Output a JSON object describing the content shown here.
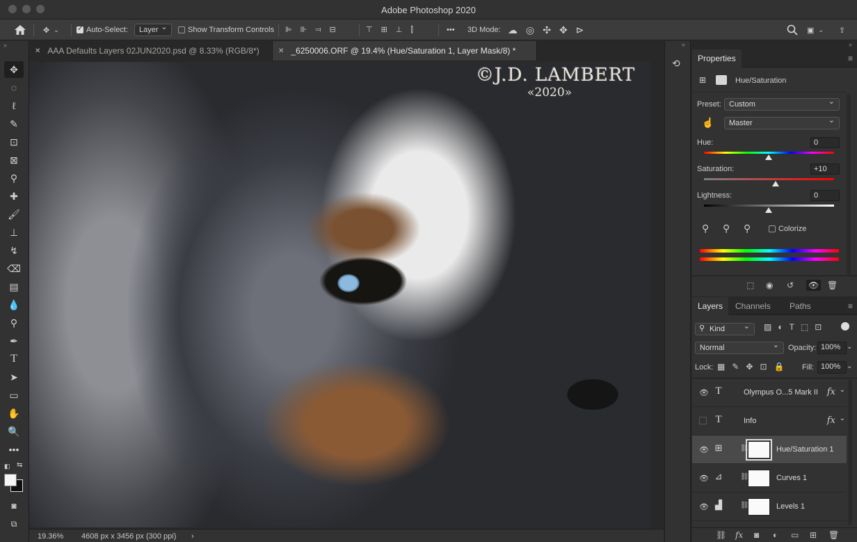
{
  "app": {
    "title": "Adobe Photoshop 2020"
  },
  "options": {
    "auto_select_label": "Auto-Select:",
    "auto_select_value": "Layer",
    "show_transform_label": "Show Transform Controls",
    "three_d_label": "3D Mode:"
  },
  "tabs": [
    {
      "label": "AAA Defaults Layers 02JUN2020.psd @ 8.33% (RGB/8*)",
      "active": false
    },
    {
      "label": "_6250006.ORF @ 19.4% (Hue/Saturation 1, Layer Mask/8) *",
      "active": true
    }
  ],
  "canvas": {
    "watermark_line1": "©J.D. LAMBERT",
    "watermark_line2": "«2020»"
  },
  "status": {
    "zoom": "19.36%",
    "doc_info": "4608 px x 3456 px (300 ppi)",
    "arrow": "›"
  },
  "properties": {
    "tab": "Properties",
    "adjustment": "Hue/Saturation",
    "preset_label": "Preset:",
    "preset_value": "Custom",
    "channel_value": "Master",
    "hue_label": "Hue:",
    "hue_value": "0",
    "saturation_label": "Saturation:",
    "saturation_value": "+10",
    "lightness_label": "Lightness:",
    "lightness_value": "0",
    "colorize_label": "Colorize"
  },
  "layers_panel": {
    "tabs": [
      "Layers",
      "Channels",
      "Paths"
    ],
    "filter_value": "Kind",
    "blend_mode": "Normal",
    "opacity_label": "Opacity:",
    "opacity_value": "100%",
    "lock_label": "Lock:",
    "fill_label": "Fill:",
    "fill_value": "100%",
    "layers": [
      {
        "name": "Olympus O...5 Mark II",
        "type": "text",
        "visible": true,
        "fx": "fx"
      },
      {
        "name": "Info",
        "type": "text",
        "visible": false,
        "fx": "fx"
      },
      {
        "name": "Hue/Saturation 1",
        "type": "adjustment",
        "visible": true,
        "selected": true
      },
      {
        "name": "Curves 1",
        "type": "adjustment",
        "visible": true
      },
      {
        "name": "Levels 1",
        "type": "adjustment",
        "visible": true
      }
    ]
  },
  "icons": {
    "home": "home-icon",
    "move": "move-icon",
    "search": "search-icon",
    "share": "share-icon"
  }
}
